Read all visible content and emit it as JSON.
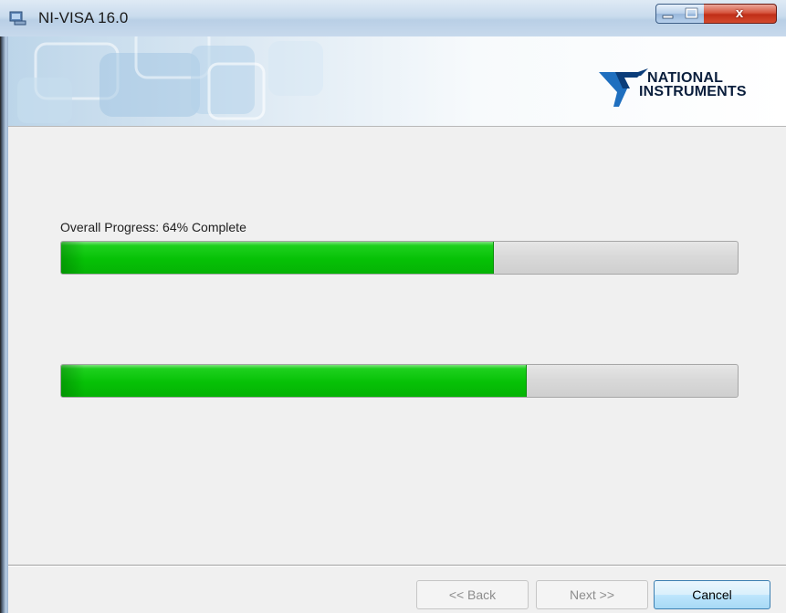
{
  "window": {
    "title": "NI-VISA 16.0",
    "close_glyph": "x",
    "icons": {
      "app": "installer-icon",
      "minimize": "minimize-icon",
      "maximize": "maximize-icon",
      "close": "close-icon"
    }
  },
  "banner": {
    "brand_line1": "NATIONAL",
    "brand_line2": "INSTRUMENTS",
    "logo_icon": "national-instruments-eagle-logo"
  },
  "progress": {
    "overall_label": "Overall Progress: 64% Complete",
    "overall_percent": 64,
    "action_percent": 68.8
  },
  "footer": {
    "back_label": "<< Back",
    "next_label": "Next >>",
    "cancel_label": "Cancel"
  },
  "colors": {
    "progress_fill": "#06c106",
    "progress_track": "#d9d9d9",
    "titlebar": "#c9dbed",
    "close_button": "#c02e17"
  }
}
